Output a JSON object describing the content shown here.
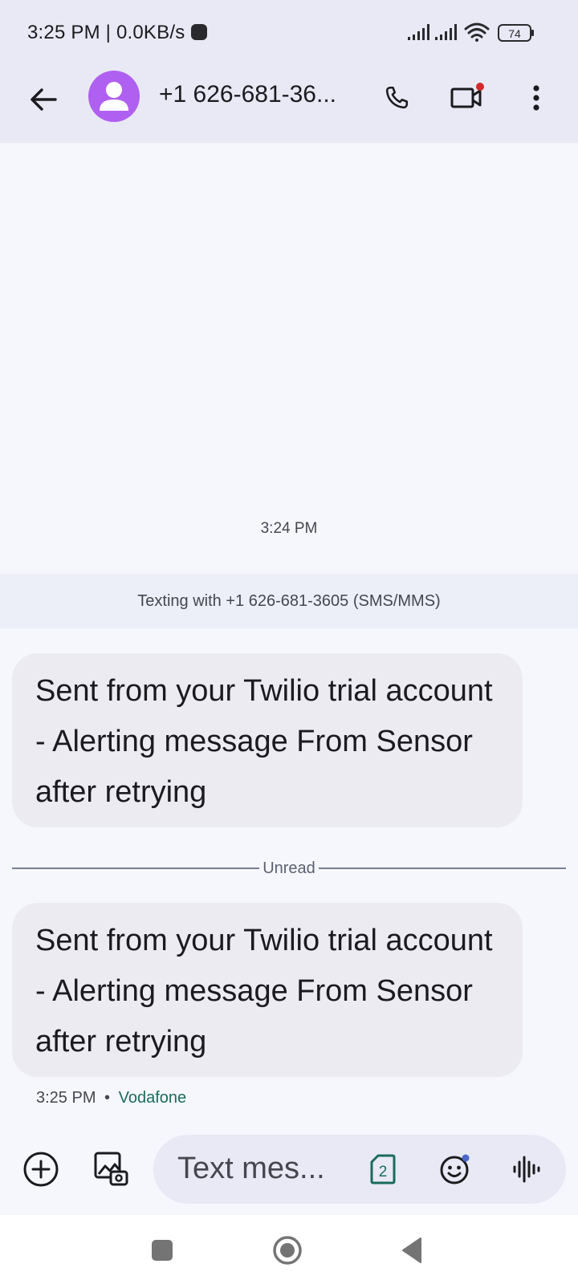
{
  "status_bar": {
    "time": "3:25 PM | 0.0KB/s",
    "battery": "74"
  },
  "header": {
    "contact": "+1 626-681-36...",
    "icons": [
      "back-arrow-icon",
      "contact-avatar-icon",
      "phone-icon",
      "video-call-icon",
      "more-vert-icon"
    ]
  },
  "conversation": {
    "timestamp": "3:24 PM",
    "texting_info": "Texting with +1 626-681-3605 (SMS/MMS)",
    "messages": [
      {
        "text": "Sent from your Twilio trial account - Alerting message From Sensor after retrying"
      },
      {
        "text": "Sent from your Twilio trial account - Alerting message From Sensor after retrying"
      }
    ],
    "unread_label": "Unread",
    "last_time": "3:25 PM",
    "separator": "•",
    "carrier": "Vodafone"
  },
  "compose": {
    "placeholder": "Text mes...",
    "sim_number": "2",
    "icons": [
      "add-circle-icon",
      "gallery-icon",
      "sim-card-icon",
      "emoji-icon",
      "voice-waveform-icon"
    ]
  },
  "colors": {
    "avatar": "#b060f0",
    "carrier_text": "#1a6b5c",
    "app_bar": "#e8e9f4",
    "bubble": "#ecebf1"
  }
}
